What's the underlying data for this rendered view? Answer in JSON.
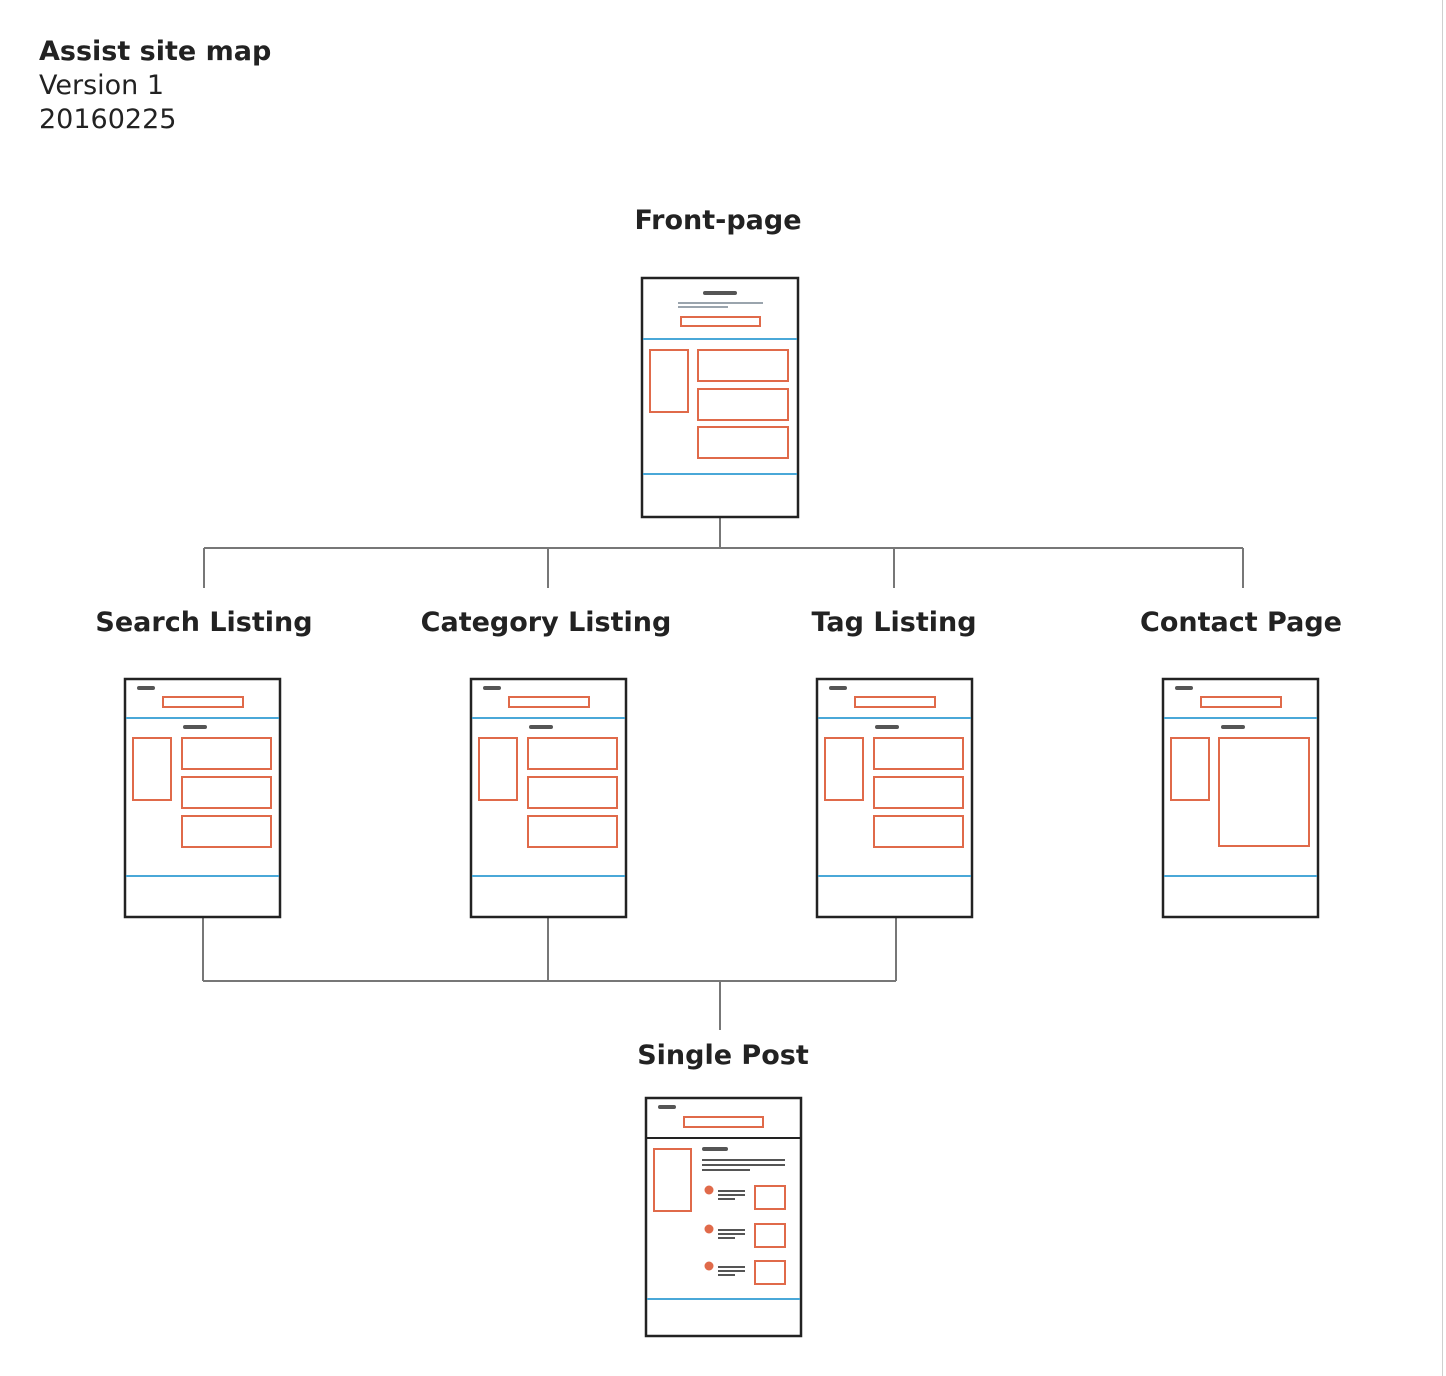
{
  "header": {
    "title": "Assist site map",
    "version": "Version 1",
    "date": "20160225"
  },
  "pages": {
    "front": "Front-page",
    "search": "Search Listing",
    "category": "Category Listing",
    "tag": "Tag Listing",
    "contact": "Contact Page",
    "single": "Single Post"
  },
  "colors": {
    "frame": "#222222",
    "accent": "#e06a4a",
    "divider": "#4aa8d8",
    "connector": "#777777",
    "placeholder": "#555555"
  },
  "icons": [
    "wireframe-thumbnail",
    "bullet-dot"
  ]
}
